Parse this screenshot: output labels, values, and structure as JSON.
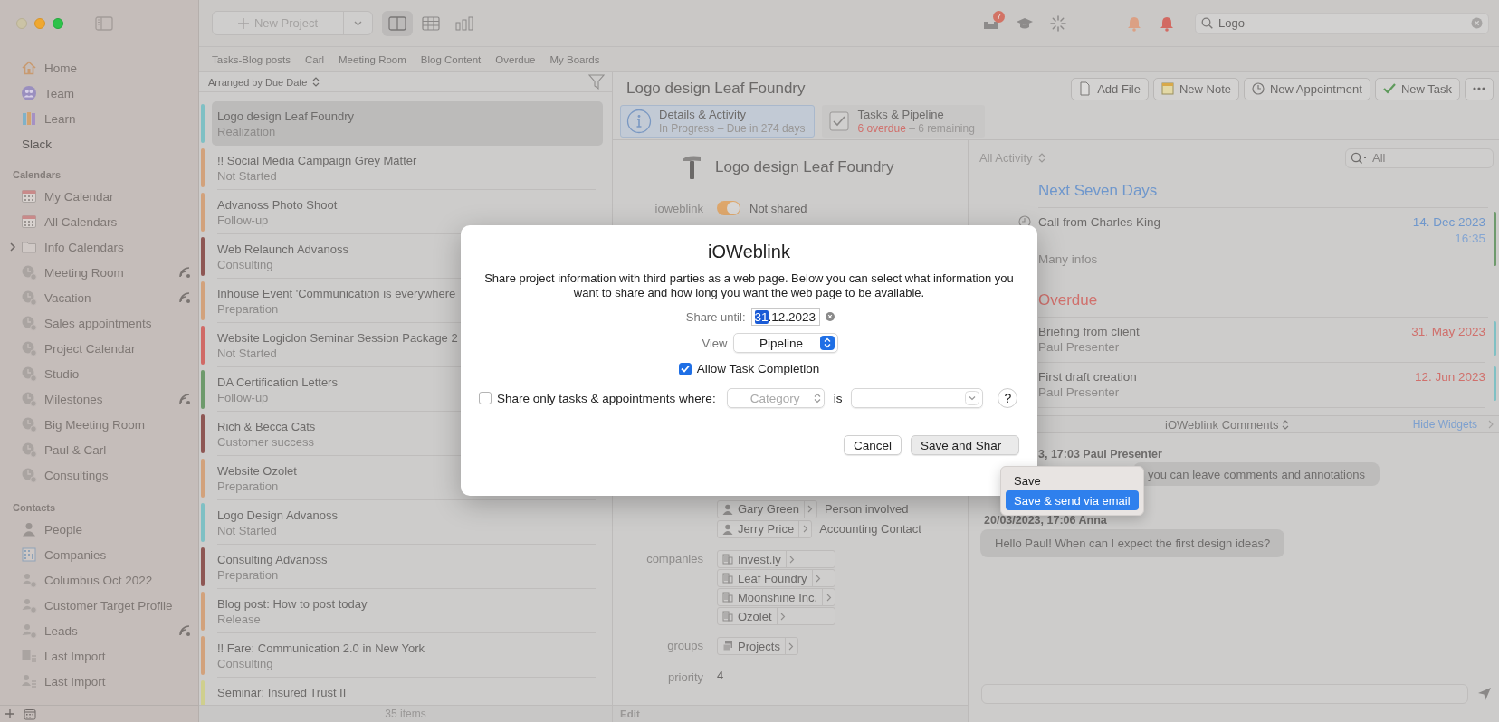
{
  "sidebar": {
    "top_items": [
      {
        "label": "Home",
        "kind": "home"
      },
      {
        "label": "Team",
        "kind": "team"
      },
      {
        "label": "Learn",
        "kind": "learn"
      },
      {
        "label": "Slack",
        "kind": "plain"
      }
    ],
    "sections": [
      {
        "title": "Calendars",
        "items": [
          {
            "label": "My Calendar",
            "kind": "calendar",
            "shared": false
          },
          {
            "label": "All Calendars",
            "kind": "calendar",
            "shared": false
          },
          {
            "label": "Info Calendars",
            "kind": "folder",
            "shared": false
          },
          {
            "label": "Meeting Room",
            "kind": "shared",
            "shared": true
          },
          {
            "label": "Vacation",
            "kind": "shared",
            "shared": true
          },
          {
            "label": "Sales appointments",
            "kind": "shared",
            "shared": false
          },
          {
            "label": "Project Calendar",
            "kind": "shared",
            "shared": false
          },
          {
            "label": "Studio",
            "kind": "shared",
            "shared": false
          },
          {
            "label": "Milestones",
            "kind": "shared",
            "shared": true
          },
          {
            "label": "Big Meeting Room",
            "kind": "shared",
            "shared": false
          },
          {
            "label": "Paul & Carl",
            "kind": "shared",
            "shared": false
          },
          {
            "label": "Consultings",
            "kind": "shared",
            "shared": false
          }
        ]
      },
      {
        "title": "Contacts",
        "items": [
          {
            "label": "People",
            "kind": "people",
            "shared": false
          },
          {
            "label": "Companies",
            "kind": "companies",
            "shared": false
          },
          {
            "label": "Columbus Oct 2022",
            "kind": "smart",
            "shared": false
          },
          {
            "label": "Customer Target Profile",
            "kind": "smart",
            "shared": false
          },
          {
            "label": "Leads",
            "kind": "smart",
            "shared": true
          },
          {
            "label": "Last Import",
            "kind": "import-company",
            "shared": false
          },
          {
            "label": "Last Import",
            "kind": "import-person",
            "shared": false
          }
        ]
      }
    ]
  },
  "toolbar": {
    "new_project": "New Project",
    "views": [
      {
        "kind": "columns",
        "selected": true
      },
      {
        "kind": "table",
        "selected": false
      },
      {
        "kind": "chart",
        "selected": false
      }
    ],
    "inbox_badge": "7",
    "search": {
      "value": "Logo"
    }
  },
  "favorites": [
    "Tasks-Blog posts",
    "Carl",
    "Meeting Room",
    "Blog Content",
    "Overdue",
    "My Boards"
  ],
  "list": {
    "sort_label": "Arranged by Due Date",
    "items": [
      {
        "title": "Logo design Leaf Foundry",
        "status": "Realization",
        "color": "#7fc0c4",
        "selected": true
      },
      {
        "title": "!! Social Media Campaign Grey Matter",
        "status": "Not Started",
        "color": "#d2a27c",
        "selected": false
      },
      {
        "title": "Advanoss Photo Shoot",
        "status": "Follow-up",
        "color": "#d2a27c",
        "selected": false
      },
      {
        "title": "Web Relaunch Advanoss",
        "status": "Consulting",
        "color": "#8e5754",
        "selected": false
      },
      {
        "title": "Inhouse Event 'Communication is everywhere",
        "status": "Preparation",
        "color": "#d2a27c",
        "selected": false
      },
      {
        "title": "Website Logiclon Seminar Session Package 2",
        "status": "Not Started",
        "color": "#d06a66",
        "selected": false
      },
      {
        "title": "DA Certification Letters",
        "status": "Follow-up",
        "color": "#6e9a6c",
        "selected": false
      },
      {
        "title": "Rich & Becca Cats",
        "status": "Customer success",
        "color": "#8e5754",
        "selected": false
      },
      {
        "title": "Website Ozolet",
        "status": "Preparation",
        "color": "#d2a27c",
        "selected": false
      },
      {
        "title": "Logo Design Advanoss",
        "status": "Not Started",
        "color": "#7fc0c4",
        "selected": false
      },
      {
        "title": "Consulting Advanoss",
        "status": "Preparation",
        "color": "#8e5754",
        "selected": false
      },
      {
        "title": "Blog post: How to post today",
        "status": "Release",
        "color": "#d2a27c",
        "selected": false
      },
      {
        "title": "!! Fare: Communication 2.0 in New York",
        "status": "Consulting",
        "color": "#d2a27c",
        "selected": false
      },
      {
        "title": "Seminar: Insured Trust II",
        "color": "#cfcf8e",
        "selected": false
      }
    ],
    "footer": "35 items"
  },
  "detail": {
    "title": "Logo design Leaf Foundry",
    "actions": [
      {
        "label": "Add File",
        "kind": "file"
      },
      {
        "label": "New Note",
        "kind": "note"
      },
      {
        "label": "New Appointment",
        "kind": "appointment"
      },
      {
        "label": "New Task",
        "kind": "task"
      }
    ],
    "tabs": [
      {
        "kind": "details",
        "title": "Details & Activity",
        "subtitle": "In Progress – Due in 274 days",
        "selected": true
      },
      {
        "kind": "tasks",
        "title": "Tasks & Pipeline",
        "overdue": "6 overdue",
        "subtitle": "– 6 remaining",
        "selected": false
      }
    ],
    "project": {
      "name": "Logo design Leaf Foundry",
      "weblink_label": "ioweblink",
      "weblink_on": true,
      "weblink_status": "Not shared",
      "people": [
        {
          "name": "Gary Green",
          "role": "Person involved"
        },
        {
          "name": "Jerry Price",
          "role": "Accounting Contact"
        }
      ],
      "fields": [
        {
          "label": "companies",
          "kind": "company",
          "values": [
            "Invest.ly",
            "Leaf Foundry",
            "Moonshine Inc.",
            "Ozolet"
          ]
        },
        {
          "label": "groups",
          "kind": "group",
          "values": [
            "Projects"
          ]
        },
        {
          "label": "priority",
          "kind": "text",
          "values": [
            "4"
          ]
        }
      ]
    },
    "footer": "Edit"
  },
  "activity": {
    "filter": "All Activity",
    "search_placeholder": "All",
    "groups": [
      {
        "title": "Next Seven Days",
        "kind": "upcoming",
        "items": [
          {
            "title": "Call from Charles King",
            "date": "14. Dec 2023",
            "time": "16:35",
            "note": "Many infos",
            "color": "#6e9a6c"
          }
        ]
      },
      {
        "title": "Overdue",
        "kind": "overdue",
        "items": [
          {
            "title": "Briefing from client",
            "person": "Paul Presenter",
            "date": "31. May 2023",
            "color": "#7fc0c4"
          },
          {
            "title": "First draft creation",
            "person": "Paul Presenter",
            "date": "12. Jun 2023",
            "color": "#7fc0c4"
          }
        ]
      }
    ],
    "comments": {
      "title": "iOWeblink Comments",
      "hide_label": "Hide Widgets",
      "entries": [
        {
          "header": "3, 17:03 Paul Presenter",
          "text": "you can leave comments and annotations"
        },
        {
          "header": "20/03/2023, 17:06 Anna",
          "text": "Hello Paul! When can I expect the first design ideas?"
        }
      ]
    }
  },
  "dialog": {
    "title": "iOWeblink",
    "description": "Share project information with third parties as a web page. Below you can select what information you want to share and how long you want the web page to be available.",
    "share_until": {
      "label": "Share until:",
      "selected": "31",
      "rest": ".12.2023"
    },
    "view": {
      "label": "View",
      "value": "Pipeline"
    },
    "allow_completion": {
      "label": "Allow Task Completion",
      "checked": true
    },
    "filter": {
      "label": "Share only tasks & appointments where:",
      "checked": false,
      "field_placeholder": "Category",
      "operator": "is",
      "help": "?"
    },
    "buttons": [
      {
        "label": "Cancel",
        "kind": "cancel"
      },
      {
        "label": "Save and Shar",
        "kind": "split"
      }
    ]
  },
  "menu": {
    "items": [
      {
        "label": "Save",
        "selected": false
      },
      {
        "label": "Save & send via email",
        "selected": true
      }
    ]
  }
}
